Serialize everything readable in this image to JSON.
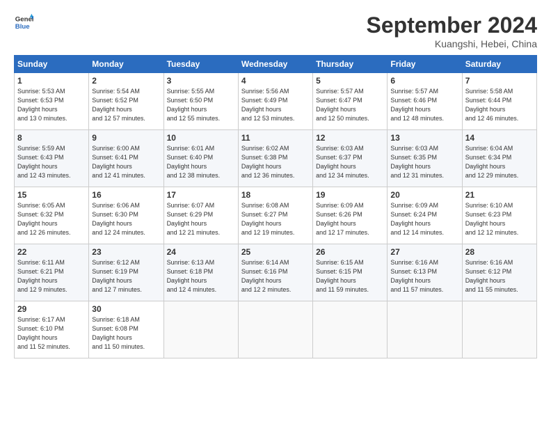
{
  "header": {
    "logo_line1": "General",
    "logo_line2": "Blue",
    "month_title": "September 2024",
    "location": "Kuangshi, Hebei, China"
  },
  "days_of_week": [
    "Sunday",
    "Monday",
    "Tuesday",
    "Wednesday",
    "Thursday",
    "Friday",
    "Saturday"
  ],
  "weeks": [
    [
      {
        "day": "1",
        "sunrise": "5:53 AM",
        "sunset": "6:53 PM",
        "daylight": "13 hours and 0 minutes."
      },
      {
        "day": "2",
        "sunrise": "5:54 AM",
        "sunset": "6:52 PM",
        "daylight": "12 hours and 57 minutes."
      },
      {
        "day": "3",
        "sunrise": "5:55 AM",
        "sunset": "6:50 PM",
        "daylight": "12 hours and 55 minutes."
      },
      {
        "day": "4",
        "sunrise": "5:56 AM",
        "sunset": "6:49 PM",
        "daylight": "12 hours and 53 minutes."
      },
      {
        "day": "5",
        "sunrise": "5:57 AM",
        "sunset": "6:47 PM",
        "daylight": "12 hours and 50 minutes."
      },
      {
        "day": "6",
        "sunrise": "5:57 AM",
        "sunset": "6:46 PM",
        "daylight": "12 hours and 48 minutes."
      },
      {
        "day": "7",
        "sunrise": "5:58 AM",
        "sunset": "6:44 PM",
        "daylight": "12 hours and 46 minutes."
      }
    ],
    [
      {
        "day": "8",
        "sunrise": "5:59 AM",
        "sunset": "6:43 PM",
        "daylight": "12 hours and 43 minutes."
      },
      {
        "day": "9",
        "sunrise": "6:00 AM",
        "sunset": "6:41 PM",
        "daylight": "12 hours and 41 minutes."
      },
      {
        "day": "10",
        "sunrise": "6:01 AM",
        "sunset": "6:40 PM",
        "daylight": "12 hours and 38 minutes."
      },
      {
        "day": "11",
        "sunrise": "6:02 AM",
        "sunset": "6:38 PM",
        "daylight": "12 hours and 36 minutes."
      },
      {
        "day": "12",
        "sunrise": "6:03 AM",
        "sunset": "6:37 PM",
        "daylight": "12 hours and 34 minutes."
      },
      {
        "day": "13",
        "sunrise": "6:03 AM",
        "sunset": "6:35 PM",
        "daylight": "12 hours and 31 minutes."
      },
      {
        "day": "14",
        "sunrise": "6:04 AM",
        "sunset": "6:34 PM",
        "daylight": "12 hours and 29 minutes."
      }
    ],
    [
      {
        "day": "15",
        "sunrise": "6:05 AM",
        "sunset": "6:32 PM",
        "daylight": "12 hours and 26 minutes."
      },
      {
        "day": "16",
        "sunrise": "6:06 AM",
        "sunset": "6:30 PM",
        "daylight": "12 hours and 24 minutes."
      },
      {
        "day": "17",
        "sunrise": "6:07 AM",
        "sunset": "6:29 PM",
        "daylight": "12 hours and 21 minutes."
      },
      {
        "day": "18",
        "sunrise": "6:08 AM",
        "sunset": "6:27 PM",
        "daylight": "12 hours and 19 minutes."
      },
      {
        "day": "19",
        "sunrise": "6:09 AM",
        "sunset": "6:26 PM",
        "daylight": "12 hours and 17 minutes."
      },
      {
        "day": "20",
        "sunrise": "6:09 AM",
        "sunset": "6:24 PM",
        "daylight": "12 hours and 14 minutes."
      },
      {
        "day": "21",
        "sunrise": "6:10 AM",
        "sunset": "6:23 PM",
        "daylight": "12 hours and 12 minutes."
      }
    ],
    [
      {
        "day": "22",
        "sunrise": "6:11 AM",
        "sunset": "6:21 PM",
        "daylight": "12 hours and 9 minutes."
      },
      {
        "day": "23",
        "sunrise": "6:12 AM",
        "sunset": "6:19 PM",
        "daylight": "12 hours and 7 minutes."
      },
      {
        "day": "24",
        "sunrise": "6:13 AM",
        "sunset": "6:18 PM",
        "daylight": "12 hours and 4 minutes."
      },
      {
        "day": "25",
        "sunrise": "6:14 AM",
        "sunset": "6:16 PM",
        "daylight": "12 hours and 2 minutes."
      },
      {
        "day": "26",
        "sunrise": "6:15 AM",
        "sunset": "6:15 PM",
        "daylight": "11 hours and 59 minutes."
      },
      {
        "day": "27",
        "sunrise": "6:16 AM",
        "sunset": "6:13 PM",
        "daylight": "11 hours and 57 minutes."
      },
      {
        "day": "28",
        "sunrise": "6:16 AM",
        "sunset": "6:12 PM",
        "daylight": "11 hours and 55 minutes."
      }
    ],
    [
      {
        "day": "29",
        "sunrise": "6:17 AM",
        "sunset": "6:10 PM",
        "daylight": "11 hours and 52 minutes."
      },
      {
        "day": "30",
        "sunrise": "6:18 AM",
        "sunset": "6:08 PM",
        "daylight": "11 hours and 50 minutes."
      },
      null,
      null,
      null,
      null,
      null
    ]
  ],
  "labels": {
    "sunrise": "Sunrise: ",
    "sunset": "Sunset: ",
    "daylight": "Daylight hours"
  }
}
